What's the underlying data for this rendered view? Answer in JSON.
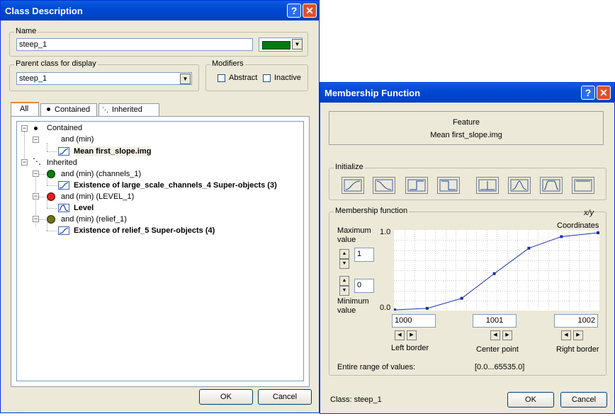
{
  "class_window": {
    "title": "Class Description",
    "name_label": "Name",
    "name_value": "steep_1",
    "color": "#007a12",
    "parent_label": "Parent class for display",
    "parent_value": "steep_1",
    "modifiers_label": "Modifiers",
    "abstract_label": "Abstract",
    "inactive_label": "Inactive",
    "tabs": [
      "All",
      "Contained",
      "Inherited"
    ],
    "tree": {
      "contained": "Contained",
      "and_min": "and (min)",
      "mean_slope": "Mean first_slope.img",
      "inherited": "Inherited",
      "and_channels": "and (min) (channels_1)",
      "existence_channels": "Existence of large_scale_channels_4 Super-objects  (3)",
      "and_level": "and (min) (LEVEL_1)",
      "level": "Level",
      "and_relief": "and (min) (relief_1)",
      "existence_relief": "Existence of relief_5 Super-objects  (4)"
    },
    "ok": "OK",
    "cancel": "Cancel"
  },
  "mf_window": {
    "title": "Membership Function",
    "feature_label": "Feature",
    "feature_value": "Mean first_slope.img",
    "initialize_label": "Initialize",
    "mf_label": "Membership function",
    "xy_label": "x/y",
    "coordinates_label": "Coordinates",
    "max_label_1": "Maximum",
    "max_label_2": "value",
    "max_value": "1",
    "min_value": "0",
    "min_label_1": "Minimum",
    "min_label_2": "value",
    "y_top": "1.0",
    "y_bottom": "0.0",
    "left_border_value": "1000",
    "center_value": "1001",
    "right_border_value": "1002",
    "left_border_label": "Left border",
    "center_label": "Center point",
    "right_border_label": "Right border",
    "range_label": "Entire range of values:",
    "range_value": "[0.0...65535.0]",
    "class_label": "Class: steep_1",
    "ok": "OK",
    "cancel": "Cancel"
  }
}
